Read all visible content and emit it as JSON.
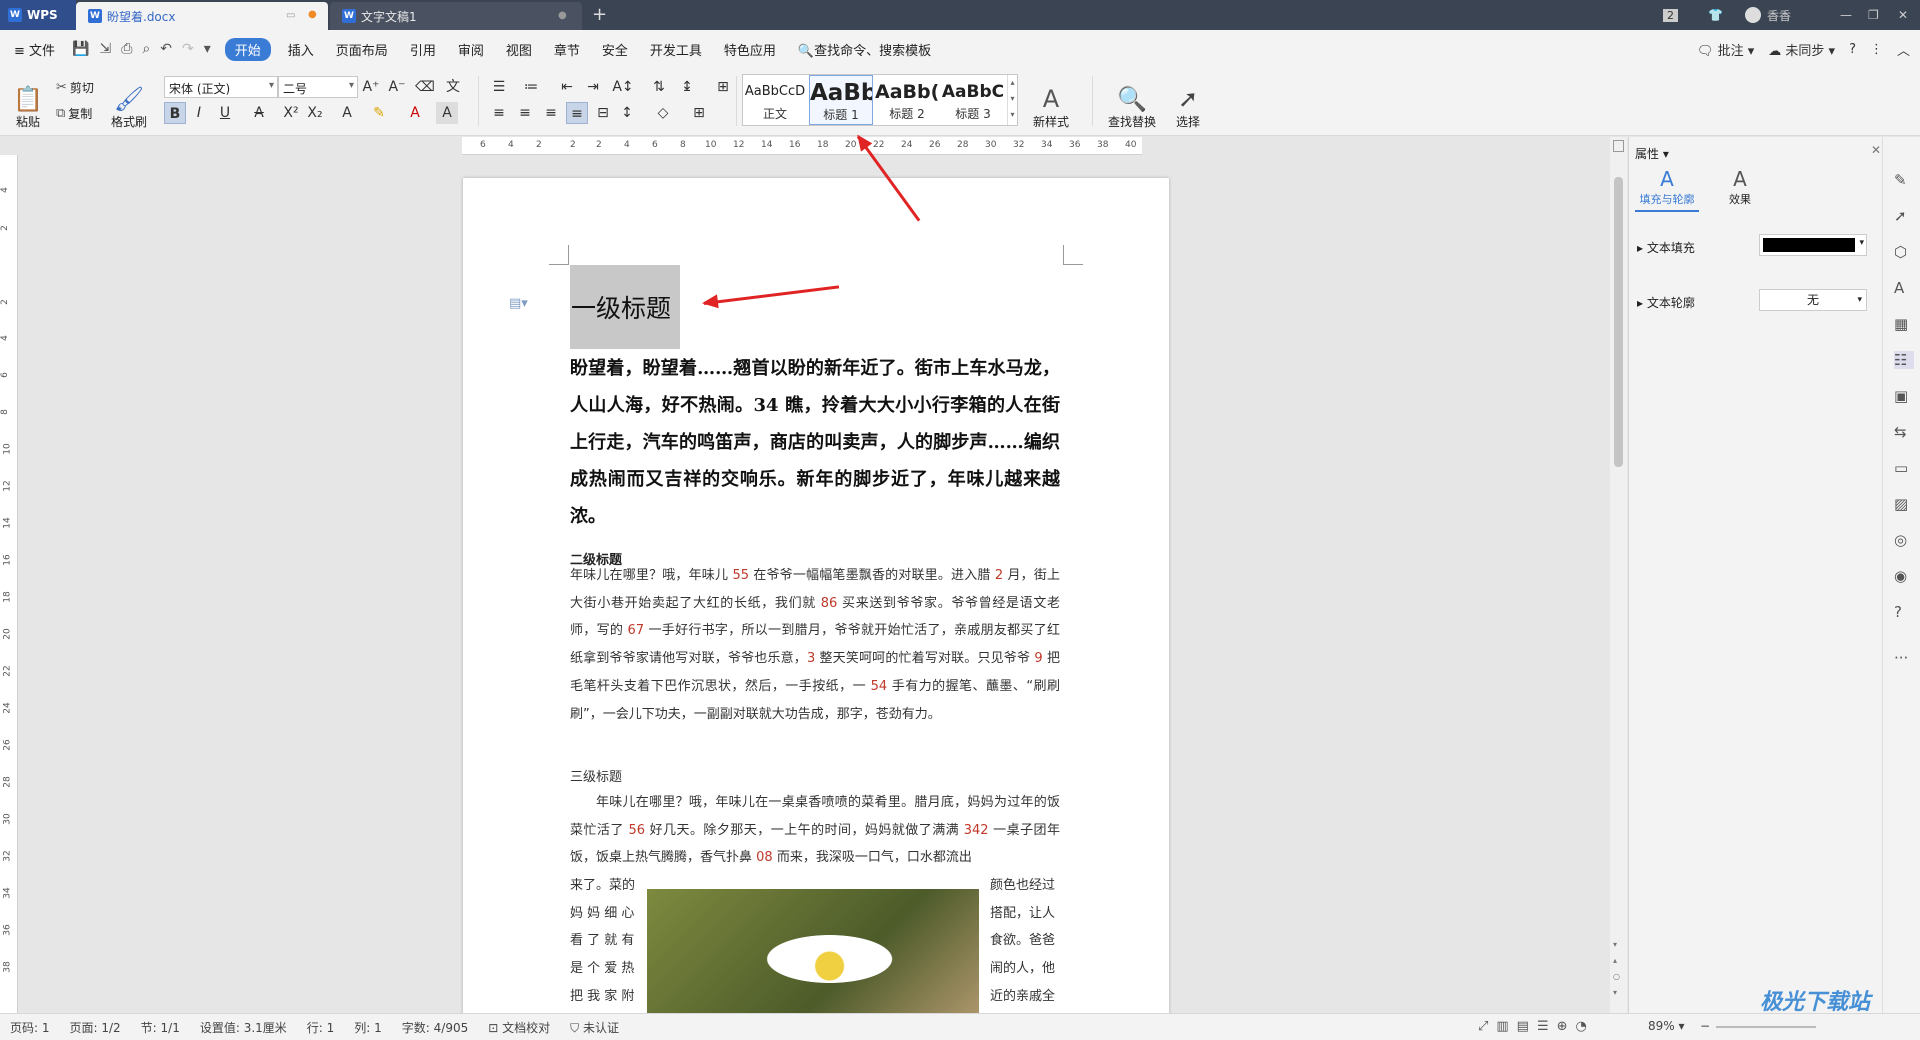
{
  "titlebar": {
    "app": "WPS",
    "tabs": [
      {
        "label": "盼望着.docx"
      },
      {
        "label": "文字文稿1"
      }
    ],
    "badge": "2",
    "user": "香香"
  },
  "menu": {
    "file": "文件",
    "items": [
      "开始",
      "插入",
      "页面布局",
      "引用",
      "审阅",
      "视图",
      "章节",
      "安全",
      "开发工具",
      "特色应用"
    ],
    "search": "查找命令、搜索模板",
    "right": [
      "批注",
      "未同步"
    ]
  },
  "ribbon": {
    "paste": "粘贴",
    "cut": "剪切",
    "copy": "复制",
    "format_painter": "格式刷",
    "font": "宋体 (正文)",
    "size": "二号",
    "styles": [
      {
        "preview": "AaBbCcD",
        "label": "正文"
      },
      {
        "preview": "AaBb",
        "label": "标题 1"
      },
      {
        "preview": "AaBb(",
        "label": "标题 2"
      },
      {
        "preview": "AaBbC",
        "label": "标题 3"
      }
    ],
    "new_style": "新样式",
    "find_replace": "查找替换",
    "select": "选择"
  },
  "ruler": {
    "numbers": [
      "6",
      "4",
      "2",
      "2",
      "2",
      "4",
      "6",
      "8",
      "10",
      "12",
      "14",
      "16",
      "18",
      "20",
      "22",
      "24",
      "26",
      "28",
      "30",
      "32",
      "34",
      "36",
      "38",
      "40"
    ]
  },
  "vruler": {
    "numbers": [
      "4",
      "2",
      "2",
      "4",
      "6",
      "8",
      "10",
      "12",
      "14",
      "16",
      "18",
      "20",
      "22",
      "24",
      "26",
      "28",
      "30",
      "32",
      "34",
      "36",
      "38"
    ]
  },
  "doc": {
    "h1": "一级标题",
    "bold_para": "盼望着，盼望着……翘首以盼的新年近了。街市上车水马龙，人山人海，好不热闹。34 瞧，拎着大大小小行李箱的人在街上行走，汽车的鸣笛声，商店的叫卖声，人的脚步声……编织成热闹而又吉祥的交响乐。新年的脚步近了，年味儿越来越浓。",
    "h2": "二级标题",
    "p2": {
      "a": "年味儿在哪里？哦，年味儿 ",
      "n1": "55",
      "b": " 在爷爷一幅幅笔墨飘香的对联里。进入腊 ",
      "n2": "2",
      "c": " 月，街上大街小巷开始卖起了大红的长纸，我们就 ",
      "n3": "86",
      "d": " 买来送到爷爷家。爷爷曾经是语文老师，写的 ",
      "n4": "67",
      "e": " 一手好行书字，所以一到腊月，爷爷就开始忙活了，亲戚朋友都买了红纸拿到爷爷家请他写对联，爷爷也乐意，",
      "n5": "3",
      "f": " 整天笑呵呵的忙着写对联。只见爷爷 ",
      "n6": "9",
      "g": " 把毛笔杆头支着下巴作沉思状，然后，一手按纸，一 ",
      "n7": "54",
      "h": " 手有力的握笔、蘸墨、“刷刷刷”，一会儿下功夫，一副副对联就大功告成，那字，苍劲有力。"
    },
    "h3": "三级标题",
    "p3": {
      "a": "年味儿在哪里？哦，年味儿在一桌桌香喷喷的菜肴里。腊月底，妈妈为过年的饭菜忙活了 ",
      "n1": "56",
      "b": " 好几天。除夕那天，一上午的时间，妈妈就做了满满 ",
      "n2": "342",
      "c": " 一桌子团年饭，饭桌上热气腾腾，香气扑鼻 ",
      "n3": "08",
      "d": " 而来，我深吸一口气，口水都流出"
    },
    "left_col": [
      "来了。菜的",
      "妈 妈 细 心",
      "看 了 就 有",
      "是 个 爱 热",
      "把 我 家 附"
    ],
    "right_col": [
      "颜色也经过",
      "搭配，让人",
      "食欲。爸爸",
      "闹的人，他",
      "近的亲戚全"
    ]
  },
  "panel": {
    "title": "属性",
    "tab1": "填充与轮廓",
    "tab2": "效果",
    "fill_label": "文本填充",
    "fill_color": "#000000",
    "outline_label": "文本轮廓",
    "outline_value": "无"
  },
  "status": {
    "items": [
      "页码: 1",
      "页面: 1/2",
      "节: 1/1",
      "设置值: 3.1厘米",
      "行: 1",
      "列: 1",
      "字数: 4/905",
      "文档校对",
      "未认证"
    ],
    "zoom": "89%"
  },
  "watermark": "极光下载站"
}
